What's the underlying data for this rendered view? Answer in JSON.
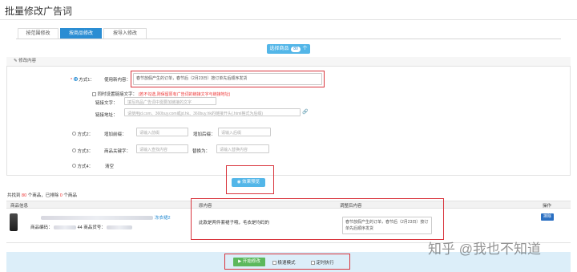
{
  "page": {
    "title": "批量修改广告词"
  },
  "tabs": [
    {
      "label": "按范围修改"
    },
    {
      "label": "按商品修改"
    },
    {
      "label": "按导入修改"
    }
  ],
  "select_button": {
    "label_pre": "选择商品",
    "count": "80",
    "label_post": "个"
  },
  "panel": {
    "header": "修改内容"
  },
  "method1": {
    "label": "方式1：",
    "field_label": "使用新内容：",
    "value": "春节放假产生的订单，春节后（2月23日）按订单先后顺序发货",
    "link_option_label": "同时设置链接文字：",
    "link_hint": "(若不勾选,则保留原有广告词的链接文字与链接地址)",
    "link_text_label": "链接文字：",
    "link_text_placeholder": "填写商品广告词中需要加链接的文字",
    "link_url_label": "链接地址：",
    "link_url_placeholder": "请使用jd.com、360buy.com或jd.hk、360buy.hk的链接开头(.html格式为后缀)"
  },
  "method2": {
    "label": "方式2：",
    "prefix_label": "增加前缀：",
    "prefix_placeholder": "请输入前缀",
    "suffix_label": "增加后缀：",
    "suffix_placeholder": "请输入后缀"
  },
  "method3": {
    "label": "方式3：",
    "keyword_label": "商品关键字：",
    "keyword_placeholder": "请输入查找内容",
    "replace_label": "替换为：",
    "replace_placeholder": "请输入替换内容"
  },
  "method4": {
    "label": "方式4：",
    "value": "清空"
  },
  "preview_button": {
    "label": "效果预览"
  },
  "summary": {
    "pre": "共找到",
    "found": "80",
    "mid": "个商品，已排除",
    "excluded": "0",
    "post": "个商品"
  },
  "table": {
    "headers": {
      "product": "商品信息",
      "original": "原内容",
      "adjusted": "调整后内容",
      "actions": "操作"
    },
    "row": {
      "name_link": "冻衣裙2",
      "code_label": "商品编码：",
      "code_value": "44",
      "store_code_label": "商品货号：",
      "original": "此款是两件套裙子哦，毛衣是均码的",
      "adjusted": "春节放假产生的订单，春节后（2月23日）按订单先后顺序发货",
      "remove_label": "排除"
    }
  },
  "footer": {
    "start_label": "开始修改",
    "fast_mode_label": "极速模式",
    "scheduled_label": "定时执行"
  },
  "watermark": {
    "text": "知乎 @我也不知道"
  },
  "colors": {
    "primary": "#2a8dd3",
    "accent": "#53b6e8",
    "danger": "#d9363e",
    "success": "#5cb85c"
  }
}
